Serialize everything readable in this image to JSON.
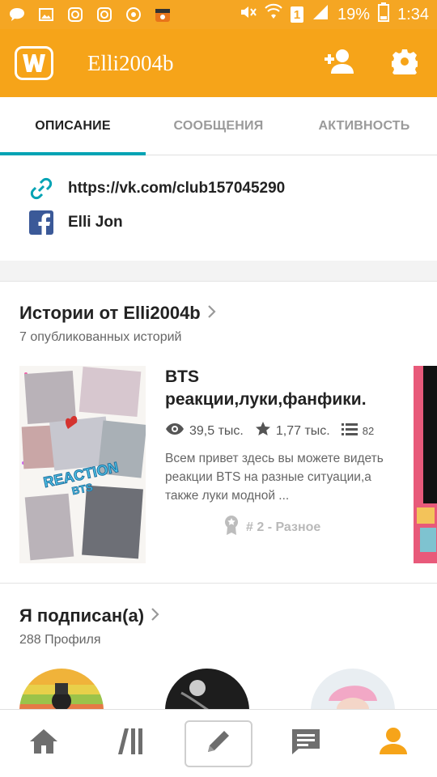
{
  "status_bar": {
    "left_icons": [
      "chat-bubble-icon",
      "image-icon",
      "instagram-icon",
      "instagram-icon",
      "chrome-icon",
      "clapperboard-icon"
    ],
    "battery_badge": "1",
    "battery_percent": "19%",
    "time": "1:34"
  },
  "app_bar": {
    "title": "Elli2004b",
    "logo_letter": "W"
  },
  "tabs": [
    {
      "label": "ОПИСАНИЕ",
      "active": true
    },
    {
      "label": "СООБЩЕНИЯ",
      "active": false
    },
    {
      "label": "АКТИВНОСТЬ",
      "active": false
    }
  ],
  "links": {
    "website": "https://vk.com/club157045290",
    "facebook": "Elli Jon"
  },
  "stories_section": {
    "title": "Истории от Elli2004b",
    "subtitle": "7 опубликованных историй",
    "story": {
      "title_line1": "BTS",
      "title_line2": "реакции,луки,фанфики.",
      "reads": "39,5 тыс.",
      "votes": "1,77 тыс.",
      "parts": "82",
      "description": "Всем привет здесь вы можете видеть реакции BTS  на разные ситуации,а также луки модной ...",
      "rank": "# 2 - Разное",
      "cover_text_1": "REACTION",
      "cover_text_2": "BTS"
    }
  },
  "following_section": {
    "title": "Я подписан(а)",
    "subtitle": "288 Профиля"
  },
  "colors": {
    "brand": "#f6a419",
    "tab_indicator": "#00a3b4",
    "link_icon": "#00a3b4",
    "facebook": "#3b5998"
  }
}
